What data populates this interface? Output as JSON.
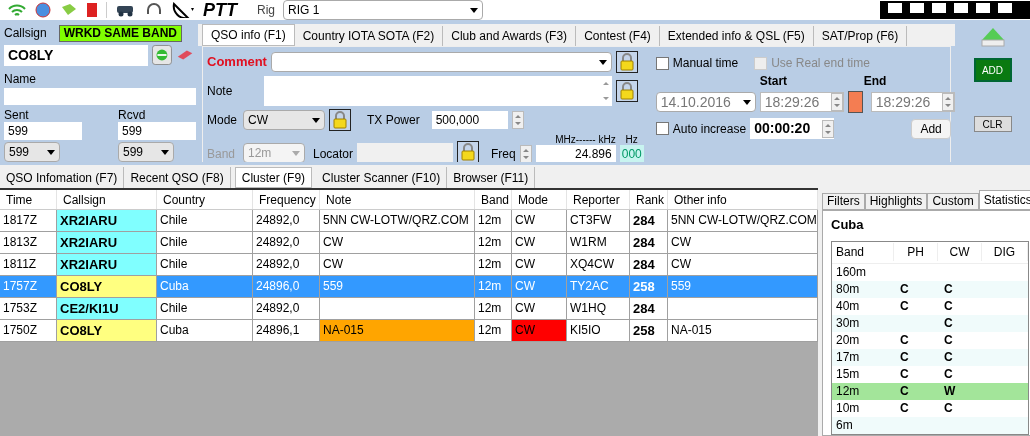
{
  "toolbar": {
    "ptt": "PTT",
    "rig_label": "Rig",
    "rig": "RIG 1"
  },
  "callsign": {
    "label": "Callsign",
    "badge": "WRKD SAME BAND",
    "value": "CO8LY"
  },
  "name": {
    "label": "Name"
  },
  "sent": {
    "label": "Sent",
    "value": "599",
    "report": "599"
  },
  "rcvd": {
    "label": "Rcvd",
    "value": "599",
    "report": "599"
  },
  "qso_tabs": [
    {
      "label": "QSO info (F1)",
      "selected": true
    },
    {
      "label": "Country IOTA SOTA (F2)",
      "selected": false
    },
    {
      "label": "Club and Awards (F3)",
      "selected": false
    },
    {
      "label": "Contest (F4)",
      "selected": false
    },
    {
      "label": "Extended info & QSL (F5)",
      "selected": false
    },
    {
      "label": "SAT/Prop (F6)",
      "selected": false
    }
  ],
  "qso_info": {
    "comment_label": "Comment",
    "note_label": "Note",
    "mode_label": "Mode",
    "mode": "CW",
    "tx_power_label": "TX Power",
    "tx_power": "500,000",
    "band_label": "Band",
    "band": "12m",
    "band_disabled": true,
    "locator_label": "Locator",
    "freq_label": "Freq",
    "freq_units": "MHz------ kHz",
    "freq": "24.896",
    "hz_label": "Hz",
    "hz": "000"
  },
  "time": {
    "manual_time": {
      "label": "Manual time",
      "checked": false,
      "disabled": false
    },
    "real_end": {
      "label": "Use Real end time",
      "checked": false,
      "disabled": true
    },
    "start_label": "Start",
    "end_label": "End",
    "date": "14.10.2016",
    "start": "18:29:26",
    "end": "18:29:26",
    "auto_increase": {
      "label": "Auto increase",
      "checked": false,
      "disabled": false
    },
    "increment": "00:00:20",
    "add_button": "Add"
  },
  "actions": {
    "add": "ADD",
    "clear": "CLR"
  },
  "bottom_tabs": [
    {
      "label": "QSO Infomation (F7)",
      "selected": false
    },
    {
      "label": "Recent QSO (F8)",
      "selected": false
    },
    {
      "label": "Cluster (F9)",
      "selected": true
    },
    {
      "label": "Cluster Scanner (F10)",
      "selected": false
    },
    {
      "label": "Browser (F11)",
      "selected": false
    }
  ],
  "table": {
    "columns": [
      "Time",
      "Callsign",
      "Country",
      "Frequency",
      "Note",
      "Band",
      "Mode",
      "Reporter",
      "Rank",
      "Other info"
    ],
    "rows": [
      {
        "selected": false,
        "time": "1817Z",
        "callsign": {
          "text": "XR2IARU",
          "color": "#80ffff"
        },
        "country": "Chile",
        "frequency": "24892,0",
        "note": "5NN CW-LOTW/QRZ.COM",
        "band": "12m",
        "mode": "CW",
        "reporter": "CT3FW",
        "rank": "284",
        "other_info": "5NN CW-LOTW/QRZ.COM"
      },
      {
        "selected": false,
        "time": "1813Z",
        "callsign": {
          "text": "XR2IARU",
          "color": "#80ffff"
        },
        "country": "Chile",
        "frequency": "24892,0",
        "note": "CW",
        "band": "12m",
        "mode": "CW",
        "reporter": "W1RM",
        "rank": "284",
        "other_info": "CW"
      },
      {
        "selected": false,
        "time": "1811Z",
        "callsign": {
          "text": "XR2IARU",
          "color": "#80ffff"
        },
        "country": "Chile",
        "frequency": "24892,0",
        "note": "CW",
        "band": "12m",
        "mode": "CW",
        "reporter": "XQ4CW",
        "rank": "284",
        "other_info": "CW"
      },
      {
        "selected": true,
        "time": "1757Z",
        "callsign": {
          "text": "CO8LY",
          "color": "#ffff80"
        },
        "country": "Cuba",
        "frequency": "24896,0",
        "note": "559",
        "band": "12m",
        "mode": "CW",
        "reporter": "TY2AC",
        "rank": "258",
        "other_info": "559"
      },
      {
        "selected": false,
        "time": "1753Z",
        "callsign": {
          "text": "CE2/KI1U",
          "color": "#80ffff"
        },
        "country": "Chile",
        "frequency": "24892,0",
        "band": "12m",
        "mode": "CW",
        "reporter": "W1HQ",
        "rank": "284"
      },
      {
        "selected": false,
        "time": "1750Z",
        "callsign": {
          "text": "CO8LY",
          "color": "#ffff80"
        },
        "country": "Cuba",
        "frequency": "24896,1",
        "note": {
          "text": "NA-015",
          "color": "#ffa500"
        },
        "band": "12m",
        "mode": {
          "text": "CW",
          "color": "#ff0000"
        },
        "reporter": "KI5IO",
        "rank": "258",
        "other_info": "NA-015"
      }
    ]
  },
  "side_tabs": [
    {
      "label": "Filters",
      "selected": false
    },
    {
      "label": "Highlights",
      "selected": false
    },
    {
      "label": "Custom",
      "selected": false
    },
    {
      "label": "Statistics",
      "selected": true
    }
  ],
  "statistics": {
    "country": "Cuba",
    "columns": [
      "Band",
      "PH",
      "CW",
      "DIG"
    ],
    "rows": [
      {
        "band": "160m",
        "selected": false
      },
      {
        "band": "80m",
        "ph": "C",
        "cw": "C",
        "selected": false
      },
      {
        "band": "40m",
        "ph": "C",
        "cw": "C",
        "selected": false
      },
      {
        "band": "30m",
        "cw": "C",
        "selected": false
      },
      {
        "band": "20m",
        "ph": "C",
        "cw": "C",
        "selected": false
      },
      {
        "band": "17m",
        "ph": "C",
        "cw": "C",
        "selected": false
      },
      {
        "band": "15m",
        "ph": "C",
        "cw": "C",
        "selected": false
      },
      {
        "band": "12m",
        "ph": "C",
        "cw": "W",
        "selected": true
      },
      {
        "band": "10m",
        "ph": "C",
        "cw": "C",
        "selected": false
      },
      {
        "band": "6m",
        "selected": false
      }
    ]
  }
}
